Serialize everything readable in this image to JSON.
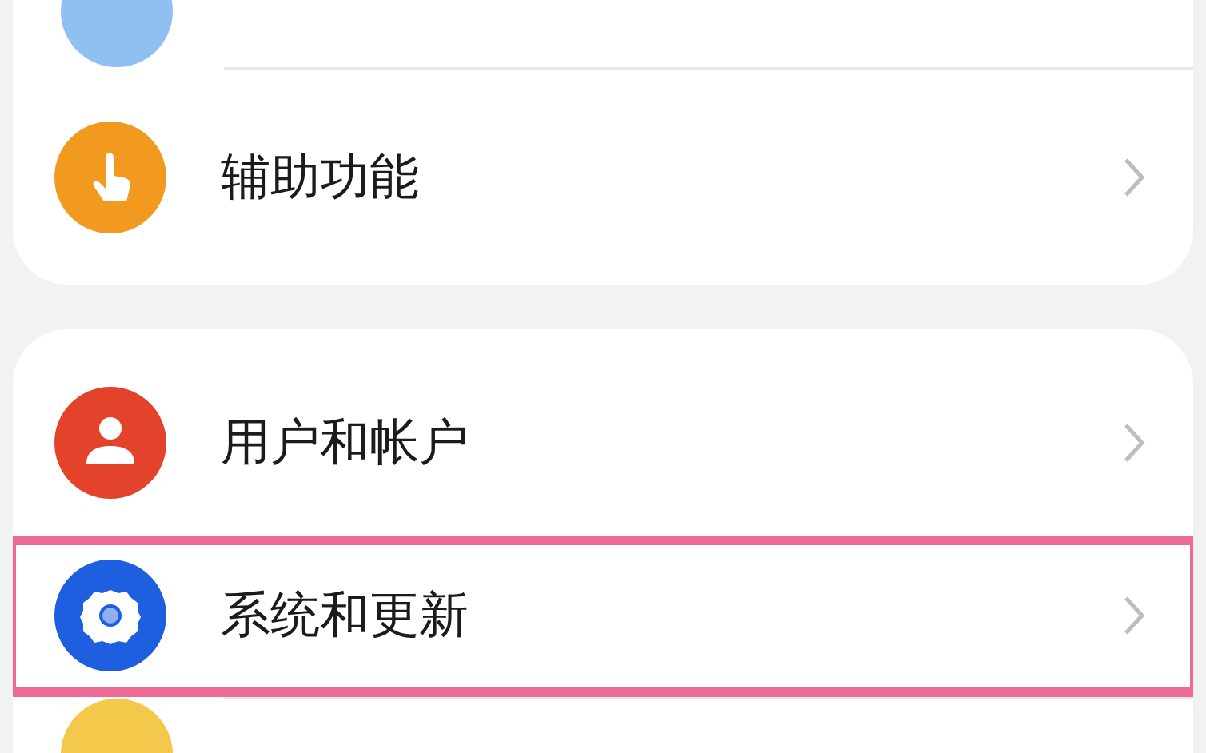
{
  "groups": [
    {
      "items": [
        {
          "kind": "blank"
        },
        {
          "kind": "hand",
          "label": "辅助功能",
          "highlighted": false
        }
      ]
    },
    {
      "items": [
        {
          "kind": "user",
          "label": "用户和帐户",
          "highlighted": false
        },
        {
          "kind": "gear",
          "label": "系统和更新",
          "highlighted": true
        },
        {
          "kind": "blank-bottom"
        }
      ]
    }
  ]
}
